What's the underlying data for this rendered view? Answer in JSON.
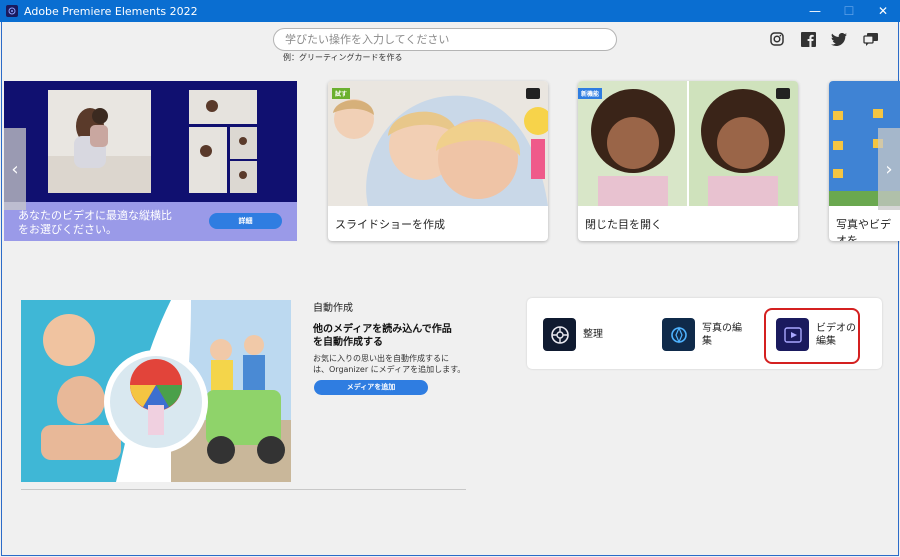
{
  "window": {
    "title": "Adobe Premiere Elements 2022",
    "controls": {
      "minimize": "—",
      "maximize": "☐",
      "close": "✕"
    }
  },
  "search": {
    "placeholder": "学びたい操作を入力してください",
    "hint": "例：グリーティングカードを作る"
  },
  "social": [
    {
      "icon": "instagram-icon"
    },
    {
      "icon": "facebook-icon"
    },
    {
      "icon": "twitter-icon"
    },
    {
      "icon": "feedback-icon"
    }
  ],
  "carousel": {
    "hero": {
      "text_line1": "あなたのビデオに最適な縦横比",
      "text_line2": "をお選びください。",
      "button": "詳細"
    },
    "cards": [
      {
        "badge": "試す",
        "label": "スライドショーを作成"
      },
      {
        "badge": "新機能",
        "label": "閉じた目を開く"
      },
      {
        "badge": "",
        "label": "写真やビデオを"
      }
    ],
    "prev_arrow": "‹",
    "next_arrow": "›"
  },
  "auto_create": {
    "title": "自動作成",
    "heading_line1": "他のメディアを読み込んで作品",
    "heading_line2": "を自動作成する",
    "desc_line1": "お気に入りの思い出を自動作成するに",
    "desc_line2": "は、Organizer にメディアを追加します。",
    "button": "メディアを追加"
  },
  "launcher": {
    "apps": [
      {
        "label_line1": "整理",
        "label_line2": "",
        "icon": "organizer-icon"
      },
      {
        "label_line1": "写真の編",
        "label_line2": "集",
        "icon": "photo-editor-icon"
      },
      {
        "label_line1": "ビデオの",
        "label_line2": "編集",
        "icon": "video-editor-icon"
      }
    ]
  },
  "colors": {
    "titlebar": "#0a6ed1",
    "accent_button": "#2f7de1",
    "highlight": "#d42020"
  }
}
